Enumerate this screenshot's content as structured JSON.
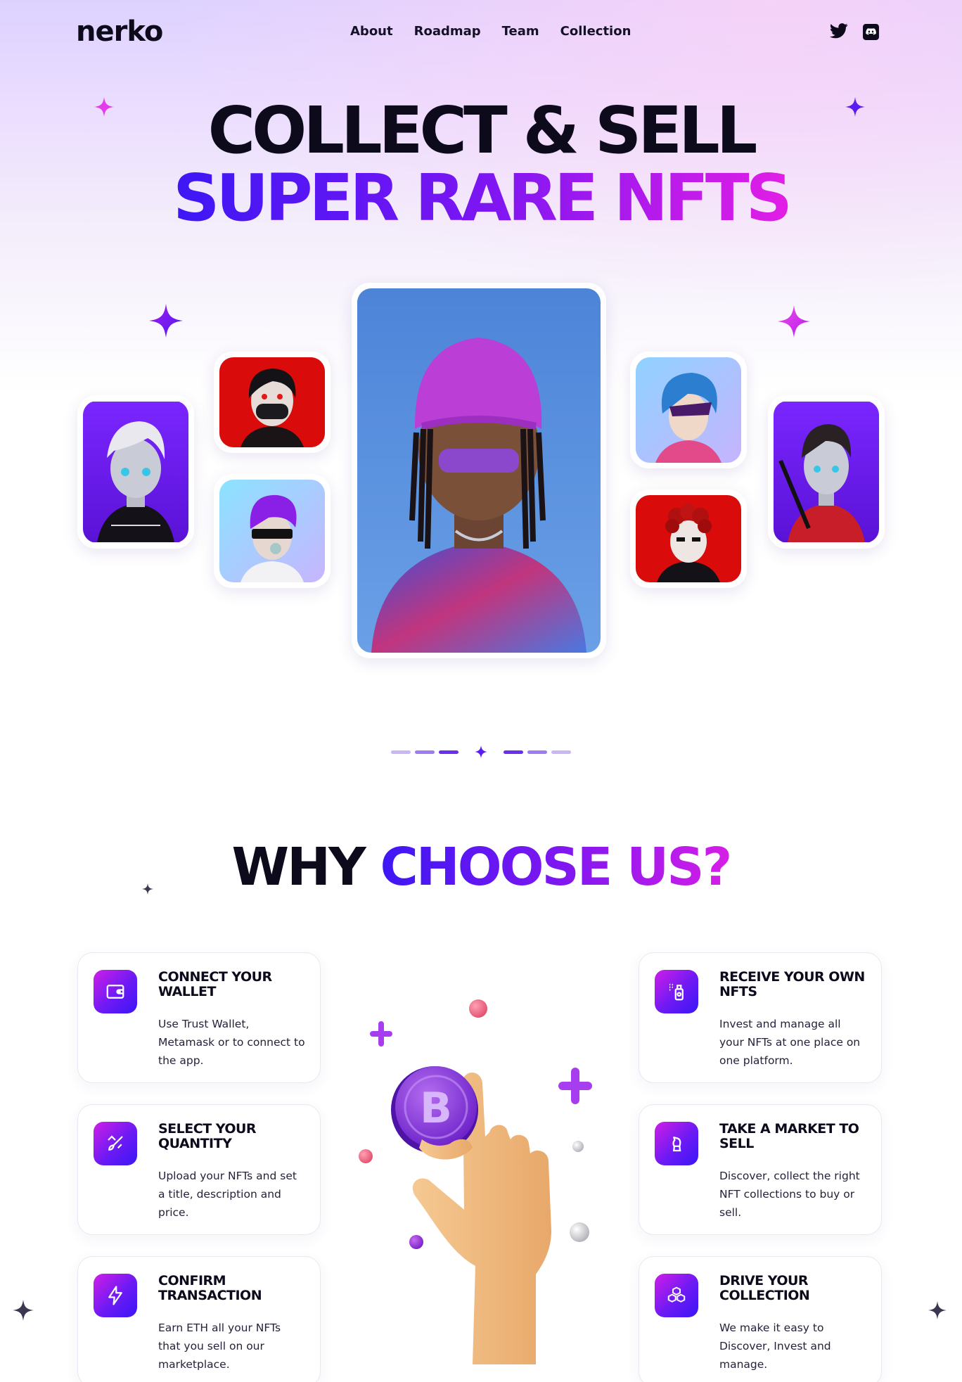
{
  "brand": {
    "logo": "nerko"
  },
  "nav": {
    "links": [
      "About",
      "Roadmap",
      "Team",
      "Collection"
    ],
    "social": [
      "twitter-icon",
      "discord-icon"
    ]
  },
  "hero": {
    "line1": "COLLECT & SELL",
    "line2": "SUPER RARE NFTS"
  },
  "why": {
    "title_part1": "WHY",
    "title_part2": "CHOOSE US?"
  },
  "features": [
    {
      "icon": "wallet-icon",
      "title": "CONNECT YOUR WALLET",
      "desc": "Use Trust Wallet, Metamask or to connect to the app."
    },
    {
      "icon": "brush-icon",
      "title": "SELECT YOUR QUANTITY",
      "desc": "Upload your NFTs and set a title, description and price."
    },
    {
      "icon": "lightning-icon",
      "title": "CONFIRM TRANSACTION",
      "desc": "Earn ETH all your NFTs that you sell on our marketplace."
    },
    {
      "icon": "spray-can-icon",
      "title": "RECEIVE YOUR OWN NFTS",
      "desc": "Invest and manage all your NFTs at one place on one platform."
    },
    {
      "icon": "chess-icon",
      "title": "TAKE A MARKET TO SELL",
      "desc": "Discover, collect the right NFT collections to buy or sell."
    },
    {
      "icon": "blocks-icon",
      "title": "DRIVE YOUR COLLECTION",
      "desc": "We make it easy to Discover, Invest and manage."
    }
  ],
  "colors": {
    "dark": "#0d0a1c",
    "blue": "#3d17f5",
    "purple": "#7b16f2",
    "pink": "#e21ee6"
  }
}
